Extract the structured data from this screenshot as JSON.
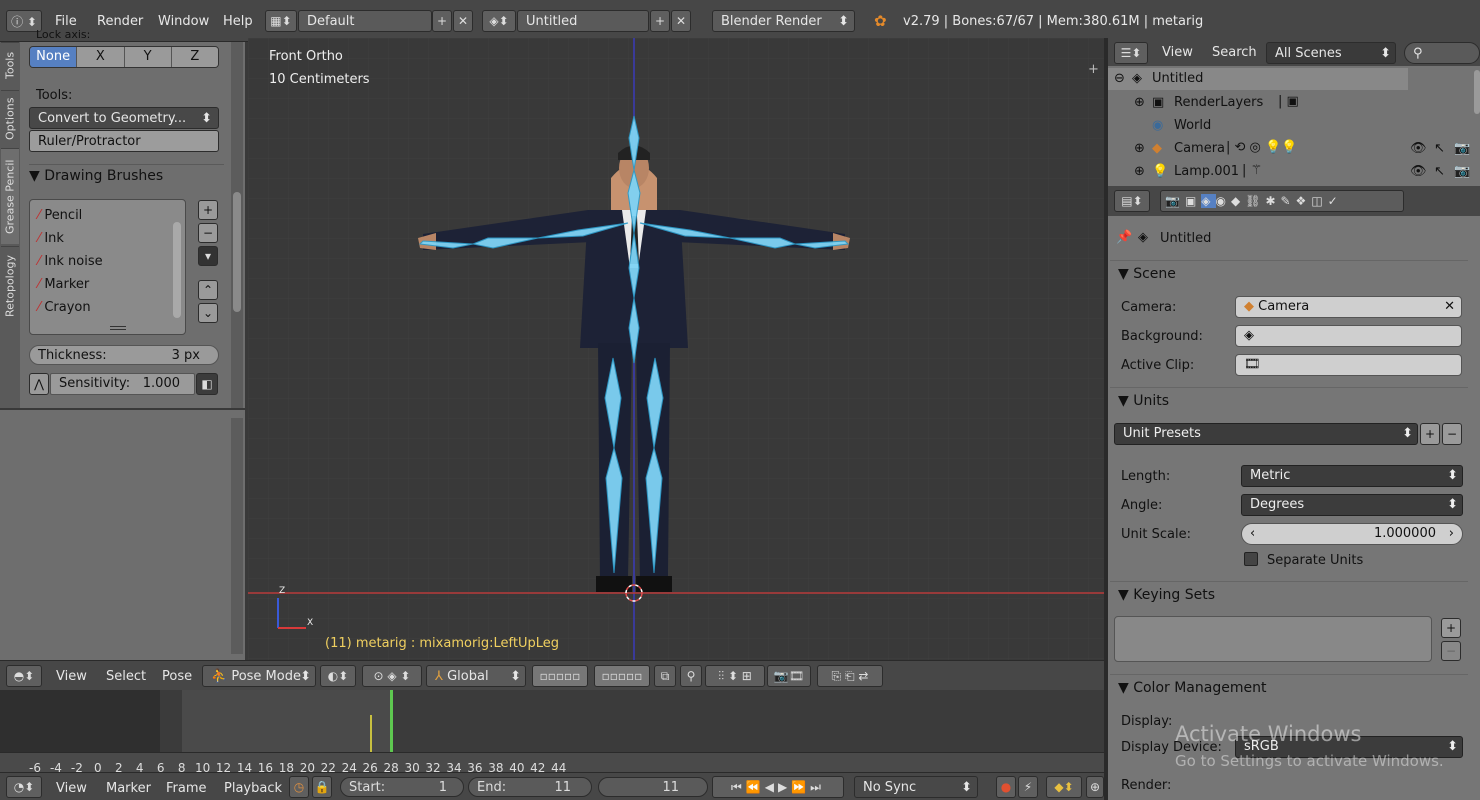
{
  "topbar": {
    "menus": [
      "File",
      "Render",
      "Window",
      "Help"
    ],
    "layout": "Default",
    "scene": "Untitled",
    "engine": "Blender Render",
    "stats": "v2.79 | Bones:67/67 | Mem:380.61M | metarig"
  },
  "toolshelf": {
    "tabs": [
      "Tools",
      "Options",
      "Grease Pencil",
      "Retopology"
    ],
    "lock_axis_label": "Lock axis:",
    "lock_axis": [
      "None",
      "X",
      "Y",
      "Z"
    ],
    "tools_label": "Tools:",
    "convert": "Convert to Geometry...",
    "ruler": "Ruler/Protractor",
    "brushes_title": "Drawing Brushes",
    "brushes": [
      "Pencil",
      "Ink",
      "Ink noise",
      "Marker",
      "Crayon"
    ],
    "thickness_label": "Thickness:",
    "thickness_value": "3 px",
    "sensitivity_label": "Sensitivity:",
    "sensitivity_value": "1.000"
  },
  "viewport": {
    "view_name": "Front Ortho",
    "scale": "10 Centimeters",
    "status": "(11) metarig : mixamorig:LeftUpLeg",
    "axis_z": "Z",
    "axis_x": "X"
  },
  "view3d_header": {
    "menus": [
      "View",
      "Select",
      "Pose"
    ],
    "mode": "Pose Mode",
    "orientation": "Global"
  },
  "outliner": {
    "menus": [
      "View",
      "Search"
    ],
    "filter": "All Scenes",
    "items": [
      "Untitled",
      "RenderLayers",
      "World",
      "Camera",
      "Lamp.001"
    ]
  },
  "properties": {
    "context": "Untitled",
    "scene_panel": "Scene",
    "camera_label": "Camera:",
    "camera_value": "Camera",
    "background_label": "Background:",
    "clip_label": "Active Clip:",
    "units_panel": "Units",
    "unit_presets": "Unit Presets",
    "length_label": "Length:",
    "length_value": "Metric",
    "angle_label": "Angle:",
    "angle_value": "Degrees",
    "scale_label": "Unit Scale:",
    "scale_value": "1.000000",
    "separate_units": "Separate Units",
    "keying_panel": "Keying Sets",
    "color_panel": "Color Management",
    "display_label": "Display:",
    "display_device_label": "Display Device:",
    "display_device_value": "sRGB",
    "render_label": "Render:"
  },
  "timeline": {
    "ticks": [
      "-6",
      "-4",
      "-2",
      "0",
      "2",
      "4",
      "6",
      "8",
      "10",
      "12",
      "14",
      "16",
      "18",
      "20",
      "22",
      "24",
      "26",
      "28",
      "30",
      "32",
      "34",
      "36",
      "38",
      "40",
      "42",
      "44"
    ],
    "current_frame_marker": 11,
    "menus": [
      "View",
      "Marker",
      "Frame",
      "Playback"
    ],
    "start_label": "Start:",
    "start_value": "1",
    "end_label": "End:",
    "end_value": "11",
    "current": "11",
    "sync": "No Sync"
  },
  "watermark": {
    "line1": "Activate Windows",
    "line2": "Go to Settings to activate Windows."
  },
  "colors": {
    "accent": "#5680c2",
    "bone": "#7fd3f5",
    "axis_red": "#b83a3a",
    "axis_blue": "#3a3ab8"
  }
}
